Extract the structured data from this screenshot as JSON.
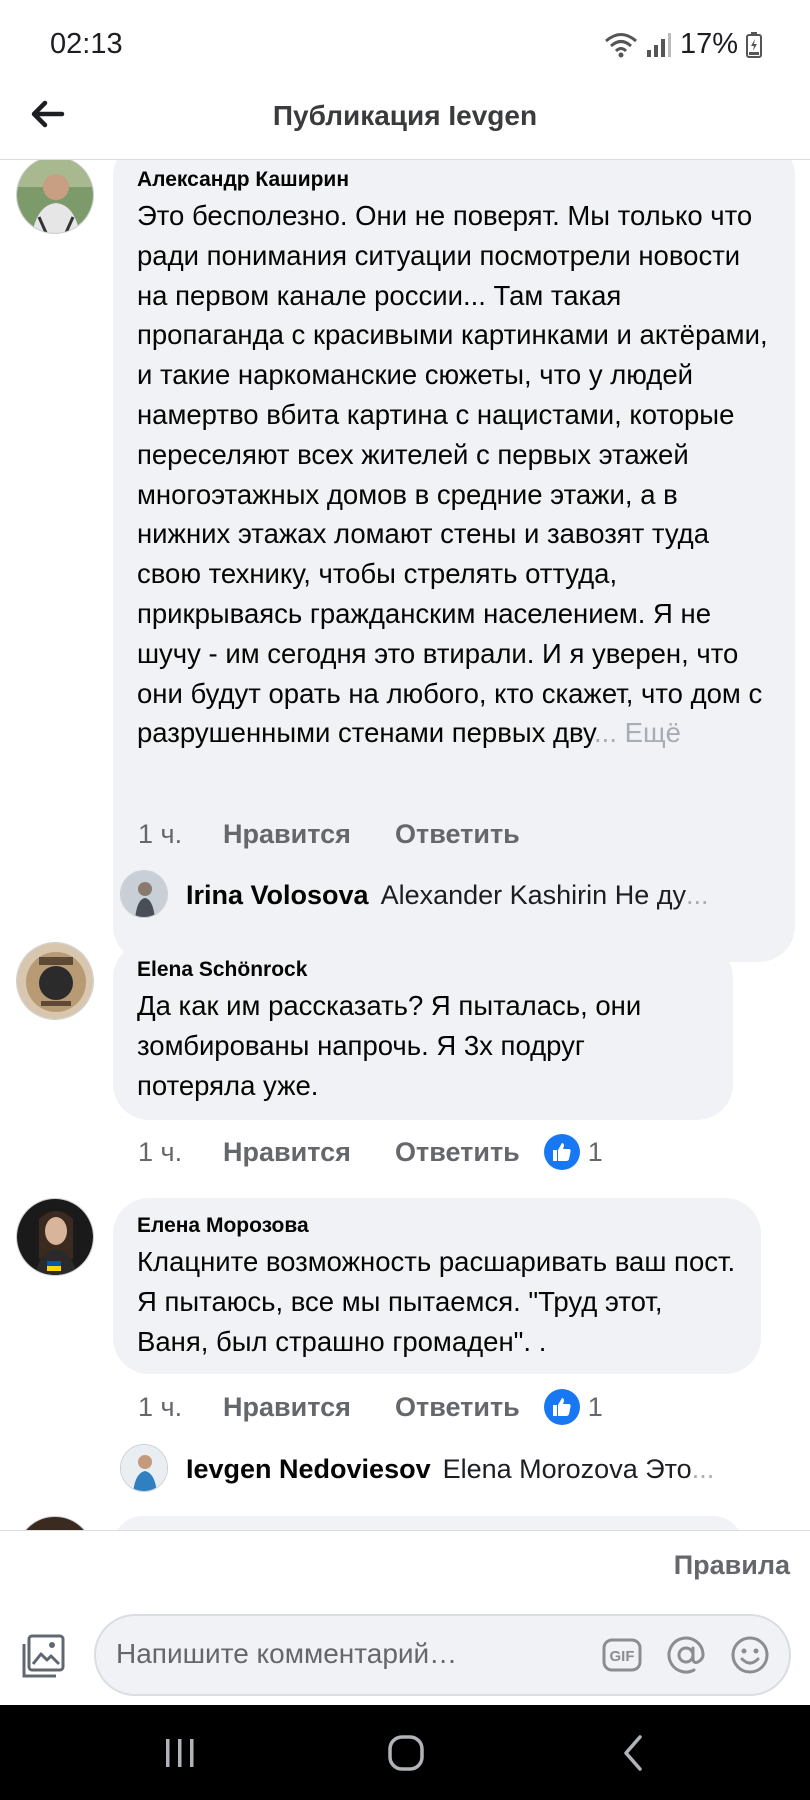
{
  "status_bar": {
    "time": "02:13",
    "battery": "17%"
  },
  "header": {
    "title": "Публикация Ievgen"
  },
  "comments": [
    {
      "author": "Александр Каширин",
      "text": "Это бесполезно. Они не поверят. Мы только что ради понимания ситуации посмотрели новости на первом канале россии... Там такая пропаганда с красивыми картинками и актёрами, и такие наркоманские сюжеты, что у людей намертво вбита картина с нацистами, которые переселяют всех жителей с первых этажей многоэтажных домов в средние этажи, а в нижних этажах ломают стены и завозят туда свою технику, чтобы стрелять оттуда, прикрываясь гражданским населением. Я не шучу - им сегодня это втирали. И я уверен, что они будут орать на любого, кто скажет, что дом с разрушенными стенами первых дву",
      "more": "... Ещё",
      "time": "1 ч.",
      "like": "Нравится",
      "reply": "Ответить"
    },
    {
      "author": "Elena Schönrock",
      "text": "Да как им рассказать? Я пыталась,  они зомбированы напрочь.  Я 3х подруг потеряла уже.",
      "time": "1 ч.",
      "like": "Нравится",
      "reply": "Ответить",
      "reactions": "1"
    },
    {
      "author": "Елена Морозова",
      "text": "Клацните возможность расшаривать ваш пост. Я пытаюсь, все мы пытаемся. \"Труд этот, Ваня, был страшно громаден\". .",
      "time": "1 ч.",
      "like": "Нравится",
      "reply": "Ответить",
      "reactions": "1"
    }
  ],
  "replies": [
    {
      "name": "Irina Volosova",
      "text": "Alexander Kashirin Не ду",
      "dots": "..."
    },
    {
      "name": "Ievgen Nedoviesov",
      "text": "Elena Morozova Это ",
      "dots": "..."
    }
  ],
  "footer": {
    "rules": "Правила",
    "placeholder": "Напишите комментарий…",
    "gif_label": "GIF"
  },
  "colors": {
    "like_blue": "#1877f2",
    "bubble_bg": "#f0f2f5",
    "meta_grey": "#65676b"
  }
}
